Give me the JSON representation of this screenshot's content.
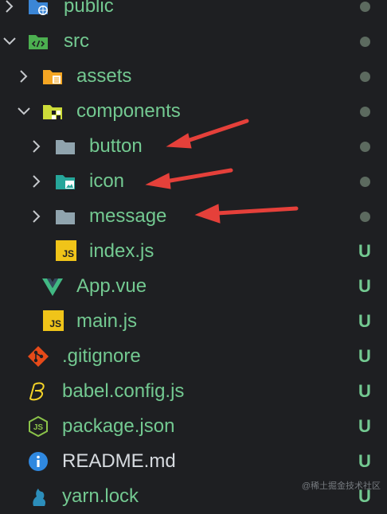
{
  "colors": {
    "background": "#1e1f22",
    "text_green": "#73c991",
    "text_white": "#d7dbe0",
    "status_green": "#73c991",
    "dot_gray": "#5c6a5f",
    "arrow_red": "#e5403a"
  },
  "tree": [
    {
      "label": "public",
      "status": ""
    },
    {
      "label": "src",
      "status": ""
    },
    {
      "label": "assets",
      "status": ""
    },
    {
      "label": "components",
      "status": ""
    },
    {
      "label": "button",
      "status": ""
    },
    {
      "label": "icon",
      "status": ""
    },
    {
      "label": "message",
      "status": ""
    },
    {
      "label": "index.js",
      "status": "U"
    },
    {
      "label": "App.vue",
      "status": "U"
    },
    {
      "label": "main.js",
      "status": "U"
    },
    {
      "label": ".gitignore",
      "status": "U"
    },
    {
      "label": "babel.config.js",
      "status": "U"
    },
    {
      "label": "package.json",
      "status": "U"
    },
    {
      "label": "README.md",
      "status": "U"
    },
    {
      "label": "yarn.lock",
      "status": "U"
    }
  ],
  "badges": {
    "js": "JS"
  },
  "watermark": "@稀土掘金技术社区"
}
